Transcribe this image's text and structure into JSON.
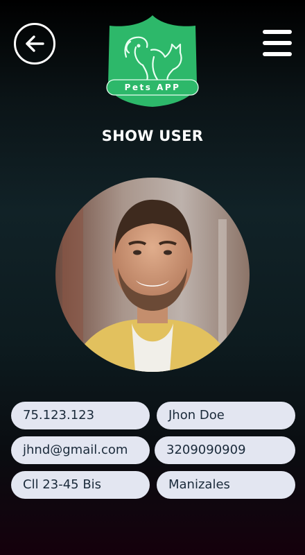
{
  "header": {
    "back_icon": "arrow-left-icon",
    "menu_icon": "hamburger-menu-icon",
    "logo": {
      "text": "Pets APP",
      "icon": "dog-cat-shield-logo",
      "color": "#2db86a"
    }
  },
  "page": {
    "title": "SHOW USER"
  },
  "user": {
    "avatar_icon": "user-photo-avatar",
    "document_id": "75.123.123",
    "name": "Jhon Doe",
    "email": "jhnd@gmail.com",
    "phone": "3209090909",
    "address": "Cll 23-45 Bis",
    "city": "Manizales"
  },
  "colors": {
    "field_background": "#e3e6f1",
    "field_text": "#1a2a3a",
    "accent_green": "#2db86a"
  }
}
